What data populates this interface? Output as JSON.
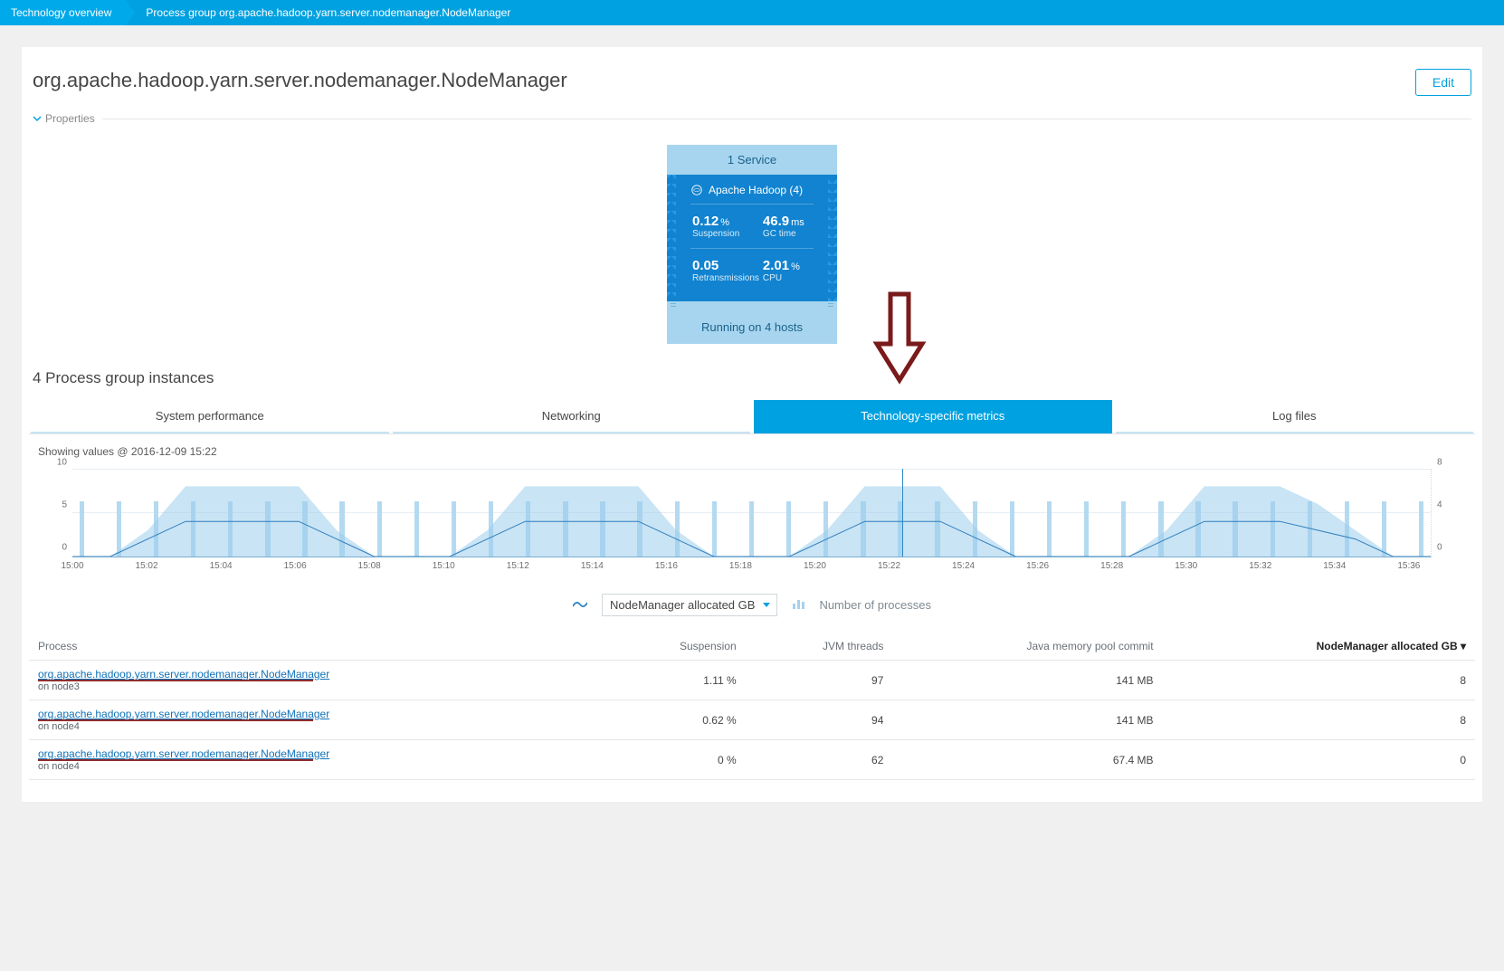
{
  "breadcrumb": {
    "parent": "Technology overview",
    "current": "Process group org.apache.hadoop.yarn.server.nodemanager.NodeManager"
  },
  "page": {
    "title": "org.apache.hadoop.yarn.server.nodemanager.NodeManager",
    "edit": "Edit",
    "properties": "Properties"
  },
  "tile": {
    "top": "1 Service",
    "header": "Apache Hadoop (4)",
    "cells": [
      {
        "value": "0.12",
        "unit": "%",
        "label": "Suspension"
      },
      {
        "value": "46.9",
        "unit": "ms",
        "label": "GC time"
      },
      {
        "value": "0.05",
        "unit": "",
        "label": "Retransmissions"
      },
      {
        "value": "2.01",
        "unit": "%",
        "label": "CPU"
      }
    ],
    "bottom": "Running on 4 hosts"
  },
  "instances": {
    "title": "4 Process group instances"
  },
  "tabs": [
    "System performance",
    "Networking",
    "Technology-specific metrics",
    "Log files"
  ],
  "active_tab": 2,
  "timestamp": "Showing values @ 2016-12-09 15:22",
  "legend": {
    "metric": "NodeManager allocated GB",
    "secondary": "Number of processes"
  },
  "table": {
    "cols": [
      "Process",
      "Suspension",
      "JVM threads",
      "Java memory pool commit",
      "NodeManager allocated GB ▾"
    ],
    "rows": [
      {
        "name": "org.apache.hadoop.yarn.server.nodemanager.NodeManager",
        "on": "on node3",
        "suspension": "1.11 %",
        "jvm": "97",
        "mem": "141 MB",
        "alloc": "8"
      },
      {
        "name": "org.apache.hadoop.yarn.server.nodemanager.NodeManager",
        "on": "on node4",
        "suspension": "0.62 %",
        "jvm": "94",
        "mem": "141 MB",
        "alloc": "8"
      },
      {
        "name": "org.apache.hadoop.yarn.server.nodemanager.NodeManager",
        "on": "on node4",
        "suspension": "0 %",
        "jvm": "62",
        "mem": "67.4 MB",
        "alloc": "0"
      }
    ]
  },
  "chart_data": {
    "type": "bar",
    "x_ticks": [
      "15:00",
      "15:02",
      "15:04",
      "15:06",
      "15:08",
      "15:10",
      "15:12",
      "15:14",
      "15:16",
      "15:18",
      "15:20",
      "15:22",
      "15:24",
      "15:26",
      "15:28",
      "15:30",
      "15:32",
      "15:34",
      "15:36"
    ],
    "y_left": {
      "label": "",
      "ticks": [
        0,
        5,
        10
      ],
      "range": [
        0,
        10
      ]
    },
    "y_right": {
      "label": "",
      "ticks": [
        0,
        4,
        8
      ],
      "range": [
        0,
        8
      ]
    },
    "series": [
      {
        "name": "Number of processes",
        "axis": "right",
        "style": "bar",
        "values": [
          5,
          5,
          5,
          5,
          5,
          5,
          5,
          5,
          5,
          5,
          5,
          5,
          5,
          5,
          5,
          5,
          5,
          5,
          5,
          5,
          5,
          5,
          5,
          5,
          5,
          5,
          5,
          5,
          5,
          5,
          5,
          5,
          5,
          5,
          5,
          5,
          5
        ]
      },
      {
        "name": "NodeManager allocated GB (area peak)",
        "axis": "left",
        "style": "area",
        "values": [
          0,
          0,
          3,
          8,
          8,
          8,
          8,
          3,
          0,
          0,
          0,
          3,
          8,
          8,
          8,
          8,
          3,
          0,
          0,
          0,
          3,
          8,
          8,
          8,
          3,
          0,
          0,
          0,
          0,
          3,
          8,
          8,
          8,
          6,
          3,
          0,
          0
        ]
      },
      {
        "name": "NodeManager allocated GB (line)",
        "axis": "left",
        "style": "line",
        "values": [
          0,
          0,
          2,
          4,
          4,
          4,
          4,
          2,
          0,
          0,
          0,
          2,
          4,
          4,
          4,
          4,
          2,
          0,
          0,
          0,
          2,
          4,
          4,
          4,
          2,
          0,
          0,
          0,
          0,
          2,
          4,
          4,
          4,
          3,
          2,
          0,
          0
        ]
      }
    ],
    "cursor_at": "15:22"
  }
}
